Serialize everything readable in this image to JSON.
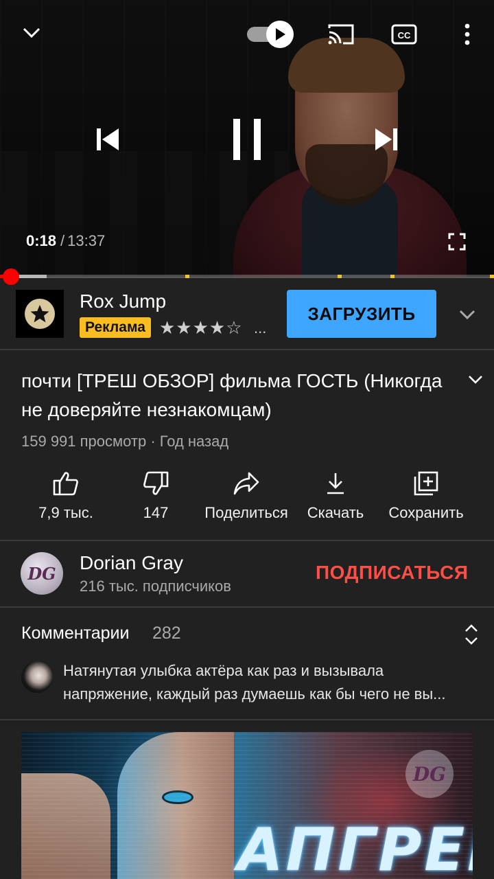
{
  "player": {
    "current_time": "0:18",
    "time_separator": "/",
    "duration": "13:37",
    "progress_fraction": 0.022,
    "buffered_fraction": 0.094,
    "ad_marker_fractions": [
      0.375,
      0.683,
      0.79,
      0.995
    ],
    "icons": {
      "collapse": "chevron-down-icon",
      "autoplay": "autoplay-toggle",
      "cast": "cast-icon",
      "captions": "cc-icon",
      "more": "more-vert-icon",
      "previous": "skip-previous-icon",
      "pause": "pause-icon",
      "next": "skip-next-icon",
      "fullscreen": "fullscreen-icon"
    },
    "accent_color": "#ff0000"
  },
  "ad": {
    "app_name": "Rox Jump",
    "badge": "Реклама",
    "rating_stars": "★★★★☆",
    "ellipsis": "...",
    "install_label": "ЗАГРУЗИТЬ",
    "install_color": "#3ea6ff",
    "badge_color": "#f9bd22"
  },
  "video": {
    "title": "почти [ТРЕШ ОБЗОР] фильма ГОСТЬ (Никогда не доверяйте незнакомцам)",
    "meta": "159 991 просмотр · Год назад"
  },
  "actions": [
    {
      "icon": "thumb-up-icon",
      "label": "7,9 тыс."
    },
    {
      "icon": "thumb-down-icon",
      "label": "147"
    },
    {
      "icon": "share-icon",
      "label": "Поделиться"
    },
    {
      "icon": "download-icon",
      "label": "Скачать"
    },
    {
      "icon": "save-playlist-icon",
      "label": "Сохранить"
    }
  ],
  "channel": {
    "avatar_text": "DG",
    "name": "Dorian Gray",
    "subscribers": "216 тыс. подписчиков",
    "subscribe_label": "ПОДПИСАТЬСЯ",
    "subscribe_color": "#ff4e45"
  },
  "comments": {
    "title": "Комментарии",
    "count": "282",
    "preview_line1": "Натянутая улыбка актёра как раз и вызывала",
    "preview_line2": "напряжение, каждый раз думаешь как бы чего не вы..."
  },
  "next_video": {
    "thumb_text": "АПГРЕЙД",
    "logo_text": "DG"
  }
}
